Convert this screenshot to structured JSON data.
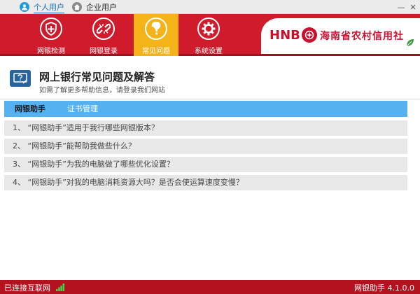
{
  "titlebar": {
    "user_tabs": [
      {
        "label": "个人用户",
        "active": true
      },
      {
        "label": "企业用户",
        "active": false
      }
    ],
    "minimize_glyph": "—",
    "close_glyph": "✕"
  },
  "nav": {
    "items": [
      {
        "label": "网银检测",
        "icon": "shield-plus-icon",
        "active": false
      },
      {
        "label": "网银登录",
        "icon": "broken-link-icon",
        "active": false
      },
      {
        "label": "常见问题",
        "icon": "question-icon",
        "active": true
      },
      {
        "label": "系统设置",
        "icon": "gear-icon",
        "active": false
      }
    ],
    "active_color": "#f5b31a",
    "header_color": "#cf1b2c"
  },
  "brand": {
    "abbr": "HNB",
    "name": "海南省农村信用社",
    "color": "#c8102e"
  },
  "page": {
    "title": "网上银行常见问题及解答",
    "subtitle": "如需了解更多帮助信息，请登录我们网站"
  },
  "tabs": [
    {
      "label": "网银助手",
      "active": true
    },
    {
      "label": "证书管理",
      "active": false
    }
  ],
  "tab_bar_color": "#55b1f0",
  "faq": [
    "1、 “网银助手”适用于我行哪些网银版本？",
    "2、 “网银助手”能帮助我做些什么？",
    "3、 “网银助手”为我的电脑做了哪些优化设置？",
    "4、 “网银助手”对我的电脑消耗资源大吗？是否会使运算速度变慢？"
  ],
  "status": {
    "connection": "已连接互联网",
    "version": "网银助手 4.1.0.0"
  }
}
